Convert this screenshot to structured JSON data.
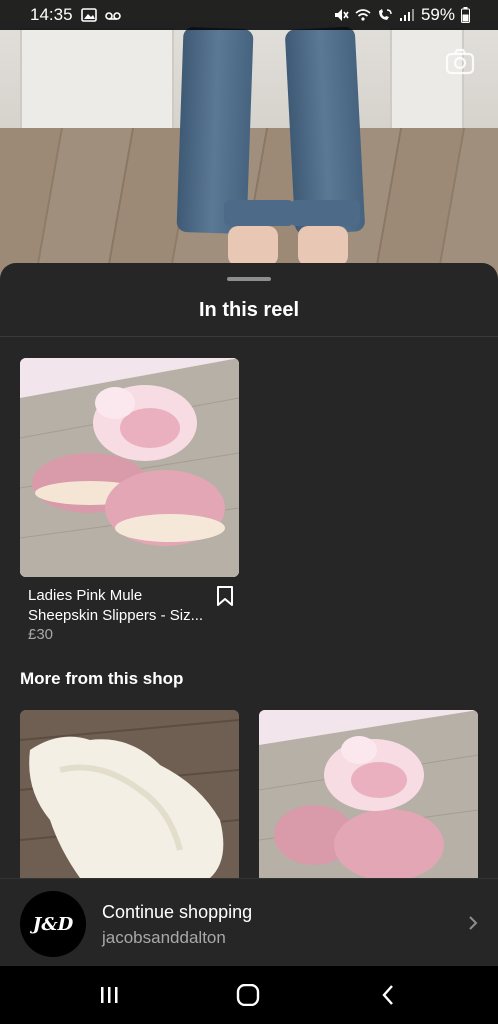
{
  "status_bar": {
    "time": "14:35",
    "battery": "59%"
  },
  "sheet": {
    "title": "In this reel",
    "product": {
      "name_line1": "Ladies Pink Mule",
      "name_line2": "Sheepskin Slippers - Siz...",
      "price": "£30"
    },
    "more_section_title": "More from this shop"
  },
  "shop_bar": {
    "avatar_text": "J&D",
    "label": "Continue shopping",
    "handle": "jacobsanddalton"
  },
  "colors": {
    "sheet_bg": "#262626",
    "secondary_text": "#a8a8a8"
  },
  "icons": [
    "image-icon",
    "voicemail-icon",
    "mute-icon",
    "wifi-icon",
    "wifi-call-icon",
    "signal-icon",
    "battery-icon",
    "camera-icon",
    "bookmark-icon",
    "chevron-right-icon",
    "recents-icon",
    "home-icon",
    "back-icon"
  ]
}
